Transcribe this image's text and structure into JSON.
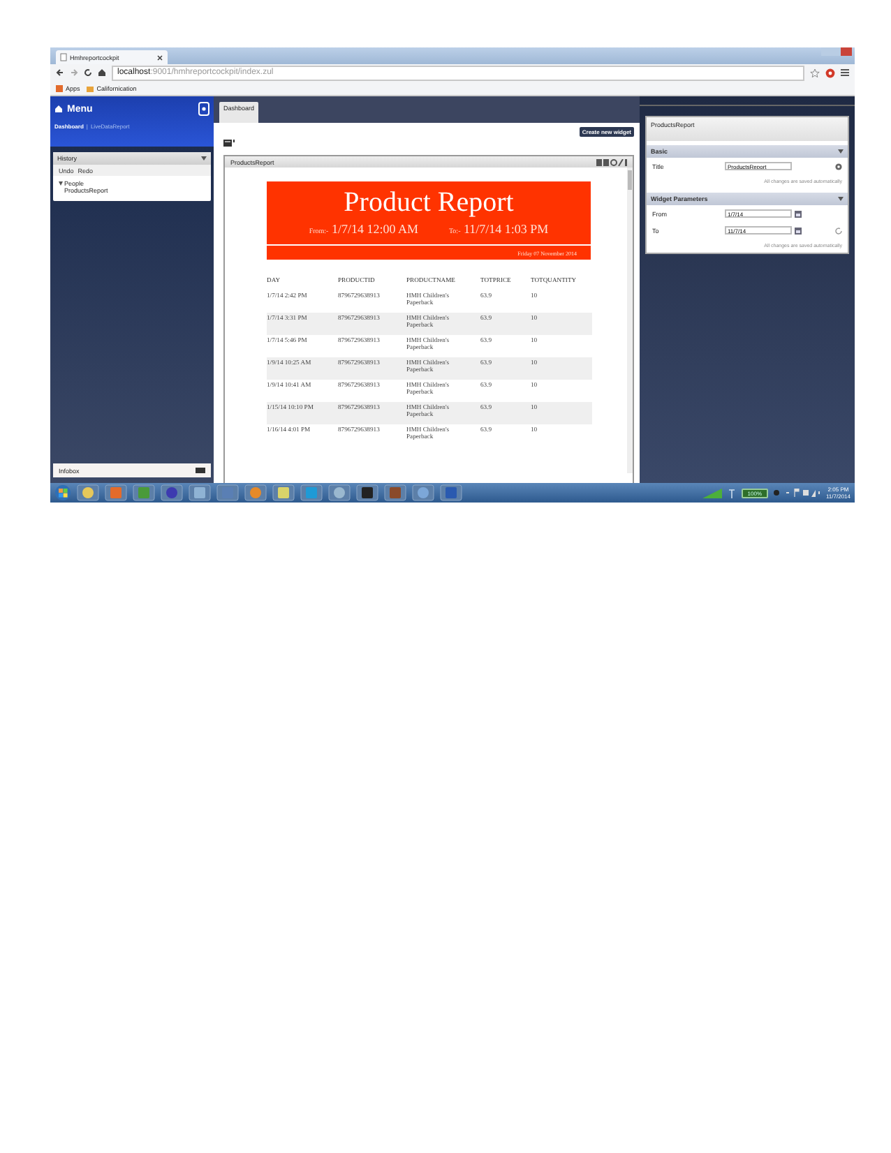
{
  "browser": {
    "tab_title": "Hmhreportcockpit",
    "address_host": "localhost",
    "address_rest": ":9001/hmhreportcockpit/index.zul",
    "bookmarks": [
      "Apps",
      "Californication"
    ]
  },
  "sidebar": {
    "menu_title": "Menu",
    "breadcrumb_separator": "|",
    "breadcrumbs": [
      {
        "label": "Dashboard",
        "selected": true
      },
      {
        "label": "LiveDataReport",
        "selected": false
      }
    ],
    "history": {
      "title": "History",
      "actions": [
        "Undo",
        "Redo"
      ],
      "items": [
        {
          "label": "People",
          "expanded": true,
          "children": [
            {
              "label": "ProductsReport"
            }
          ]
        }
      ]
    },
    "infobox": "Infobox"
  },
  "center": {
    "tab": "Dashboard",
    "create_button": "Create new widget",
    "widget": {
      "title": "ProductsReport",
      "report": {
        "title": "Product Report",
        "from_label": "From:-",
        "from": "1/7/14 12:00 AM",
        "to_label": "To:-",
        "to": "11/7/14 1:03 PM",
        "date": "Friday 07 November 2014",
        "columns": [
          "DAY",
          "PRODUCTID",
          "PRODUCTNAME",
          "TOTPRICE",
          "TOTQUANTITY"
        ],
        "rows": [
          [
            "1/7/14 2:42 PM",
            "8796729638913",
            "HMH Children's Paperback",
            "63.9",
            "10"
          ],
          [
            "1/7/14 3:31 PM",
            "8796729638913",
            "HMH Children's Paperback",
            "63.9",
            "10"
          ],
          [
            "1/7/14 5:46 PM",
            "8796729638913",
            "HMH Children's Paperback",
            "63.9",
            "10"
          ],
          [
            "1/9/14 10:25 AM",
            "8796729638913",
            "HMH Children's Paperback",
            "63.9",
            "10"
          ],
          [
            "1/9/14 10:41 AM",
            "8796729638913",
            "HMH Children's Paperback",
            "63.9",
            "10"
          ],
          [
            "1/15/14 10:10 PM",
            "8796729638913",
            "HMH Children's Paperback",
            "63.9",
            "10"
          ],
          [
            "1/16/14 4:01 PM",
            "8796729638913",
            "HMH Children's Paperback",
            "63.9",
            "10"
          ]
        ]
      }
    }
  },
  "properties": {
    "title": "ProductsReport",
    "sections": [
      {
        "title": "Basic",
        "fields": [
          {
            "label": "Title",
            "value": "ProductsReport"
          }
        ],
        "note": "All changes are saved automatically"
      },
      {
        "title": "Widget Parameters",
        "fields": [
          {
            "label": "From",
            "value": "1/7/14"
          },
          {
            "label": "To",
            "value": "11/7/14"
          }
        ],
        "note": "All changes are saved automatically"
      }
    ]
  },
  "taskbar": {
    "battery": "100%",
    "time": "2:05 PM",
    "date": "11/7/2014"
  }
}
